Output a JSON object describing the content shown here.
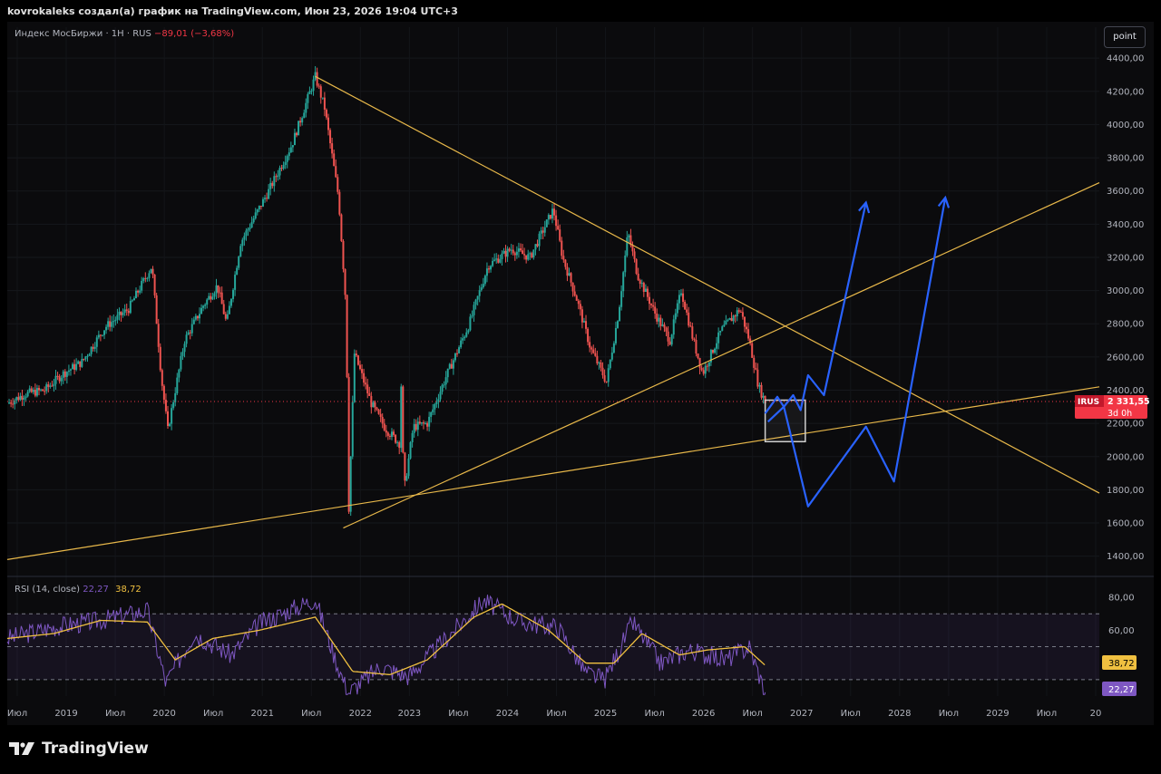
{
  "header": {
    "caption": "kovrokaleks создал(а) график на TradingView.com, Июн 23, 2026 19:04 UTC+3"
  },
  "legend": {
    "symbol": "Индекс МосБиржи · 1Н · RUS",
    "change": "−89,01 (−3,68%)"
  },
  "toolbar": {
    "point_label": "point"
  },
  "price_tag": {
    "ticker": "IRUS",
    "price": "2 331,55",
    "timer": "3d 0h"
  },
  "rsi_legend": {
    "label": "RSI (14, close)",
    "rsi_value": "22,27",
    "ma_value": "38,72"
  },
  "brand": {
    "name": "TradingView"
  },
  "colors": {
    "background": "#0b0b0d",
    "up": "#26a69a",
    "down": "#ef5350",
    "trendline": "#e8b84a",
    "projection": "#2962ff",
    "rsi_line": "#7e57c2",
    "rsi_ma": "#f0c040",
    "price_tag": "#f23645"
  },
  "chart_data": [
    {
      "type": "candlestick",
      "title": "Индекс МосБиржи · 1Н · RUS",
      "y_ticks": [
        "4400,00",
        "4200,00",
        "4000,00",
        "3800,00",
        "3600,00",
        "3400,00",
        "3200,00",
        "3000,00",
        "2800,00",
        "2600,00",
        "2400,00",
        "2200,00",
        "2000,00",
        "1800,00",
        "1600,00",
        "1400,00"
      ],
      "ylim": [
        1300,
        4450
      ],
      "x_ticks": [
        "Июл",
        "2019",
        "Июл",
        "2020",
        "Июл",
        "2021",
        "Июл",
        "2022",
        "2023",
        "Июл",
        "2024",
        "Июл",
        "2025",
        "Июл",
        "2026",
        "Июл",
        "2027",
        "Июл",
        "2028",
        "Июл",
        "2029",
        "Июл",
        "20"
      ],
      "xlim": [
        2018.5,
        2030.2
      ],
      "series": [
        {
          "approx_closes": [
            {
              "t": 2018.5,
              "v": 2320
            },
            {
              "t": 2018.7,
              "v": 2380
            },
            {
              "t": 2018.9,
              "v": 2400
            },
            {
              "t": 2019.1,
              "v": 2500
            },
            {
              "t": 2019.3,
              "v": 2570
            },
            {
              "t": 2019.55,
              "v": 2780
            },
            {
              "t": 2019.8,
              "v": 2890
            },
            {
              "t": 2020.05,
              "v": 3150
            },
            {
              "t": 2020.15,
              "v": 2480
            },
            {
              "t": 2020.22,
              "v": 2160
            },
            {
              "t": 2020.4,
              "v": 2700
            },
            {
              "t": 2020.6,
              "v": 2910
            },
            {
              "t": 2020.75,
              "v": 3030
            },
            {
              "t": 2020.85,
              "v": 2800
            },
            {
              "t": 2021.0,
              "v": 3290
            },
            {
              "t": 2021.3,
              "v": 3600
            },
            {
              "t": 2021.55,
              "v": 3880
            },
            {
              "t": 2021.8,
              "v": 4290
            },
            {
              "t": 2021.9,
              "v": 4100
            },
            {
              "t": 2022.05,
              "v": 3560
            },
            {
              "t": 2022.13,
              "v": 2900
            },
            {
              "t": 2022.16,
              "v": 1690
            },
            {
              "t": 2022.22,
              "v": 2620
            },
            {
              "t": 2022.4,
              "v": 2320
            },
            {
              "t": 2022.55,
              "v": 2170
            },
            {
              "t": 2022.7,
              "v": 2080
            },
            {
              "t": 2022.72,
              "v": 2430
            },
            {
              "t": 2022.75,
              "v": 1790
            },
            {
              "t": 2022.85,
              "v": 2180
            },
            {
              "t": 2023.0,
              "v": 2200
            },
            {
              "t": 2023.2,
              "v": 2480
            },
            {
              "t": 2023.45,
              "v": 2800
            },
            {
              "t": 2023.65,
              "v": 3150
            },
            {
              "t": 2023.9,
              "v": 3250
            },
            {
              "t": 2024.1,
              "v": 3200
            },
            {
              "t": 2024.35,
              "v": 3490
            },
            {
              "t": 2024.45,
              "v": 3200
            },
            {
              "t": 2024.6,
              "v": 2950
            },
            {
              "t": 2024.75,
              "v": 2650
            },
            {
              "t": 2024.92,
              "v": 2450
            },
            {
              "t": 2025.05,
              "v": 2870
            },
            {
              "t": 2025.15,
              "v": 3350
            },
            {
              "t": 2025.25,
              "v": 3100
            },
            {
              "t": 2025.45,
              "v": 2850
            },
            {
              "t": 2025.6,
              "v": 2700
            },
            {
              "t": 2025.72,
              "v": 3000
            },
            {
              "t": 2025.85,
              "v": 2700
            },
            {
              "t": 2025.95,
              "v": 2500
            },
            {
              "t": 2026.15,
              "v": 2760
            },
            {
              "t": 2026.35,
              "v": 2890
            },
            {
              "t": 2026.45,
              "v": 2700
            },
            {
              "t": 2026.55,
              "v": 2420
            },
            {
              "t": 2026.62,
              "v": 2331.55
            }
          ]
        }
      ],
      "last_price": 2331.55,
      "trendlines": [
        {
          "name": "descending resistance",
          "from": {
            "t": 2021.8,
            "v": 4290
          },
          "to": {
            "t": 2030.2,
            "v": 1780
          }
        },
        {
          "name": "rising support",
          "from": {
            "t": 2022.1,
            "v": 1570
          },
          "to": {
            "t": 2030.2,
            "v": 3650
          }
        },
        {
          "name": "long-term support",
          "from": {
            "t": 2018.5,
            "v": 1380
          },
          "to": {
            "t": 2030.2,
            "v": 2420
          }
        }
      ],
      "annotations": [
        {
          "type": "rectangle",
          "from": {
            "t": 2026.62,
            "v": 2340
          },
          "to": {
            "t": 2027.05,
            "v": 2090
          }
        },
        {
          "type": "projection_path",
          "points": [
            {
              "t": 2026.62,
              "v": 2260
            },
            {
              "t": 2026.75,
              "v": 2360
            },
            {
              "t": 2026.82,
              "v": 2300
            },
            {
              "t": 2026.92,
              "v": 2370
            },
            {
              "t": 2027.0,
              "v": 2280
            },
            {
              "t": 2027.08,
              "v": 2490
            },
            {
              "t": 2027.25,
              "v": 2370
            },
            {
              "t": 2027.7,
              "v": 3530
            }
          ]
        },
        {
          "type": "projection_path",
          "points": [
            {
              "t": 2026.65,
              "v": 2210
            },
            {
              "t": 2026.82,
              "v": 2300
            },
            {
              "t": 2027.08,
              "v": 1700
            },
            {
              "t": 2027.7,
              "v": 2180
            },
            {
              "t": 2028.0,
              "v": 1850
            },
            {
              "t": 2028.55,
              "v": 3560
            }
          ]
        }
      ],
      "grid": true
    },
    {
      "type": "line",
      "title": "RSI (14, close)",
      "y_ticks": [
        "80,00",
        "60,00"
      ],
      "ylim": [
        20,
        85
      ],
      "bands": {
        "upper": 70,
        "middle": 50,
        "lower": 30
      },
      "series": [
        {
          "name": "RSI",
          "last": 22.27,
          "approx_values": [
            {
              "t": 2018.5,
              "v": 55
            },
            {
              "t": 2019.0,
              "v": 62
            },
            {
              "t": 2019.5,
              "v": 66
            },
            {
              "t": 2020.0,
              "v": 72
            },
            {
              "t": 2020.2,
              "v": 28
            },
            {
              "t": 2020.5,
              "v": 58
            },
            {
              "t": 2020.9,
              "v": 45
            },
            {
              "t": 2021.2,
              "v": 64
            },
            {
              "t": 2021.8,
              "v": 79
            },
            {
              "t": 2022.0,
              "v": 45
            },
            {
              "t": 2022.15,
              "v": 22
            },
            {
              "t": 2022.5,
              "v": 38
            },
            {
              "t": 2022.8,
              "v": 32
            },
            {
              "t": 2023.2,
              "v": 55
            },
            {
              "t": 2023.6,
              "v": 78
            },
            {
              "t": 2024.0,
              "v": 65
            },
            {
              "t": 2024.4,
              "v": 62
            },
            {
              "t": 2024.7,
              "v": 34
            },
            {
              "t": 2024.9,
              "v": 30
            },
            {
              "t": 2025.2,
              "v": 65
            },
            {
              "t": 2025.5,
              "v": 40
            },
            {
              "t": 2025.8,
              "v": 48
            },
            {
              "t": 2026.2,
              "v": 42
            },
            {
              "t": 2026.45,
              "v": 50
            },
            {
              "t": 2026.62,
              "v": 22.27
            }
          ]
        },
        {
          "name": "RSI MA",
          "last": 38.72,
          "approx_values": [
            {
              "t": 2018.5,
              "v": 55
            },
            {
              "t": 2019.0,
              "v": 58
            },
            {
              "t": 2019.5,
              "v": 66
            },
            {
              "t": 2020.0,
              "v": 65
            },
            {
              "t": 2020.3,
              "v": 42
            },
            {
              "t": 2020.7,
              "v": 55
            },
            {
              "t": 2021.2,
              "v": 60
            },
            {
              "t": 2021.8,
              "v": 68
            },
            {
              "t": 2022.2,
              "v": 35
            },
            {
              "t": 2022.6,
              "v": 33
            },
            {
              "t": 2023.0,
              "v": 42
            },
            {
              "t": 2023.5,
              "v": 68
            },
            {
              "t": 2023.8,
              "v": 76
            },
            {
              "t": 2024.3,
              "v": 60
            },
            {
              "t": 2024.7,
              "v": 40
            },
            {
              "t": 2025.0,
              "v": 40
            },
            {
              "t": 2025.3,
              "v": 58
            },
            {
              "t": 2025.7,
              "v": 45
            },
            {
              "t": 2026.0,
              "v": 48
            },
            {
              "t": 2026.4,
              "v": 50
            },
            {
              "t": 2026.62,
              "v": 38.72
            }
          ]
        }
      ],
      "tags": [
        "38,72",
        "22,27"
      ]
    }
  ]
}
